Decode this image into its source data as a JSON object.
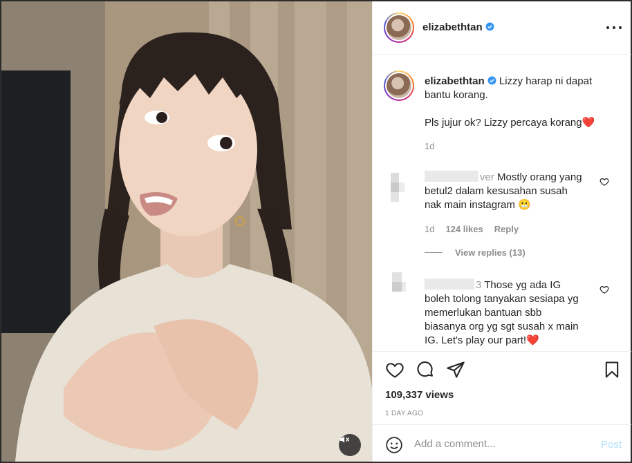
{
  "post": {
    "username": "elizabethtan",
    "verified_icon": "verified-badge-icon",
    "more_icon": "more-options-icon"
  },
  "caption": {
    "username": "elizabethtan",
    "line1": "Lizzy harap ni dapat",
    "line2": "bantu korang.",
    "line3": "Pls jujur ok? Lizzy percaya korang",
    "emoji": "❤️",
    "time": "1d"
  },
  "comments": [
    {
      "username_visible": "ver",
      "lines": [
        "Mostly orang yang",
        "betul2 dalam kesusahan susah",
        "nak main instagram"
      ],
      "emoji": "😬",
      "time": "1d",
      "likes": "124 likes",
      "reply_label": "Reply",
      "view_replies": "View replies (13)"
    },
    {
      "username_visible": "3",
      "lines": [
        "Those yg ada IG",
        "boleh tolong tanyakan sesiapa yg",
        "memerlukan bantuan sbb",
        "biasanya org yg sgt susah x main",
        "IG. Let's play our part!"
      ],
      "emoji": "❤️"
    }
  ],
  "actions": {
    "like_icon": "heart-icon",
    "comment_icon": "comment-icon",
    "share_icon": "paper-plane-icon",
    "save_icon": "bookmark-icon",
    "views": "109,337 views",
    "posted": "1 DAY AGO"
  },
  "add_comment": {
    "placeholder": "Add a comment...",
    "post_label": "Post",
    "emoji_icon": "smiley-icon"
  },
  "media": {
    "mute_icon": "speaker-muted-icon"
  }
}
